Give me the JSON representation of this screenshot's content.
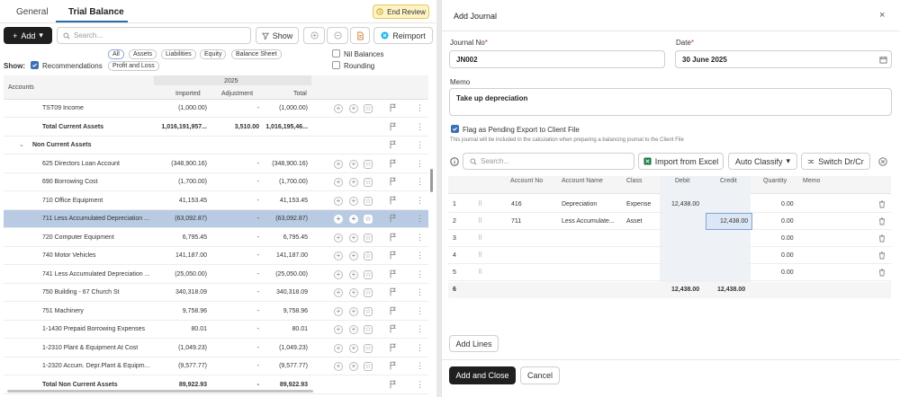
{
  "tabs": [
    {
      "label": "General"
    },
    {
      "label": "Trial Balance"
    }
  ],
  "end_review": "End Review",
  "toolbar": {
    "add_label": "Add",
    "search_placeholder": "Search...",
    "show_label": "Show",
    "reimport_label": "Reimport"
  },
  "filters": {
    "show_label": "Show:",
    "recommendations": "Recommendations",
    "pills": [
      "All",
      "Assets",
      "Liabilities",
      "Equity",
      "Balance Sheet",
      "Profit and Loss"
    ],
    "nil_balances": "Nil Balances",
    "rounding": "Rounding"
  },
  "table": {
    "accounts_header": "Accounts",
    "year": "2025",
    "imported": "Imported",
    "adjustment": "Adjustment",
    "total": "Total"
  },
  "rows": [
    {
      "name": "TST09 Income",
      "imported": "(1,000.00)",
      "adjustment": "-",
      "total": "(1,000.00)",
      "type": "item"
    },
    {
      "name": "Total Current Assets",
      "imported": "1,016,191,957...",
      "adjustment": "3,510.00",
      "total": "1,016,195,46...",
      "type": "total"
    },
    {
      "name": "Non Current Assets",
      "imported": "",
      "adjustment": "",
      "total": "",
      "type": "group"
    },
    {
      "name": "625 Directors Loan Account",
      "imported": "(348,900.16)",
      "adjustment": "-",
      "total": "(348,900.16)",
      "type": "item"
    },
    {
      "name": "690 Borrowing Cost",
      "imported": "(1,700.00)",
      "adjustment": "-",
      "total": "(1,700.00)",
      "type": "item"
    },
    {
      "name": "710 Office Equipment",
      "imported": "41,153.45",
      "adjustment": "-",
      "total": "41,153.45",
      "type": "item"
    },
    {
      "name": "711 Less Accumulated Depreciation ...",
      "imported": "(63,092.87)",
      "adjustment": "-",
      "total": "(63,092.87)",
      "type": "selected"
    },
    {
      "name": "720 Computer Equipment",
      "imported": "6,795.45",
      "adjustment": "-",
      "total": "6,795.45",
      "type": "item"
    },
    {
      "name": "740 Motor Vehicles",
      "imported": "141,187.00",
      "adjustment": "-",
      "total": "141,187.00",
      "type": "item"
    },
    {
      "name": "741 Less Accumulated Depreciation ...",
      "imported": "(25,050.00)",
      "adjustment": "-",
      "total": "(25,050.00)",
      "type": "item"
    },
    {
      "name": "750 Building - 67 Church St",
      "imported": "340,318.09",
      "adjustment": "-",
      "total": "340,318.09",
      "type": "item"
    },
    {
      "name": "751 Machinery",
      "imported": "9,758.96",
      "adjustment": "-",
      "total": "9,758.96",
      "type": "item"
    },
    {
      "name": "1-1430 Prepaid Borrowing Expenses",
      "imported": "80.01",
      "adjustment": "-",
      "total": "80.01",
      "type": "item"
    },
    {
      "name": "1-2310 Plant & Equipment At Cost",
      "imported": "(1,049.23)",
      "adjustment": "-",
      "total": "(1,049.23)",
      "type": "item"
    },
    {
      "name": "1-2320 Accum. Depr.Plant & Equipm...",
      "imported": "(9,577.77)",
      "adjustment": "-",
      "total": "(9,577.77)",
      "type": "item"
    },
    {
      "name": "Total Non Current Assets",
      "imported": "89,922.93",
      "adjustment": "-",
      "total": "89,922.93",
      "type": "total"
    }
  ],
  "dialog": {
    "title": "Add Journal",
    "journal_no_label": "Journal No",
    "journal_no": "JN002",
    "date_label": "Date",
    "date": "30 June 2025",
    "memo_label": "Memo",
    "memo": "Take up depreciation",
    "flag_label": "Flag as Pending Export to Client File",
    "flag_note": "This journal will be included in the calculation when preparing a balancing journal to the Client File",
    "search_placeholder": "Search...",
    "import_excel": "Import from Excel",
    "auto_classify": "Auto Classify",
    "switch": "Switch Dr/Cr",
    "columns": [
      "Account No",
      "Account Name",
      "Class",
      "Debit",
      "Credit",
      "Quantity",
      "Memo"
    ],
    "lines": [
      {
        "n": "1",
        "account_no": "416",
        "account_name": "Depreciation",
        "class": "Expense",
        "debit": "12,438.00",
        "credit": "",
        "quantity": "0.00"
      },
      {
        "n": "2",
        "account_no": "711",
        "account_name": "Less Accumulate...",
        "class": "Asset",
        "debit": "",
        "credit": "12,438.00",
        "quantity": "0.00"
      },
      {
        "n": "3",
        "account_no": "",
        "account_name": "",
        "class": "",
        "debit": "",
        "credit": "",
        "quantity": "0.00"
      },
      {
        "n": "4",
        "account_no": "",
        "account_name": "",
        "class": "",
        "debit": "",
        "credit": "",
        "quantity": "0.00"
      },
      {
        "n": "5",
        "account_no": "",
        "account_name": "",
        "class": "",
        "debit": "",
        "credit": "",
        "quantity": "0.00"
      }
    ],
    "totals": {
      "n": "6",
      "debit": "12,438.00",
      "credit": "12,438.00"
    },
    "add_lines": "Add Lines",
    "add_close": "Add and Close",
    "cancel": "Cancel"
  },
  "colors": {
    "accent": "#2b6cb0",
    "selected_row": "#b8cbe3",
    "dark_button": "#1f1f1f",
    "end_review_bg": "#fdf3c4"
  }
}
